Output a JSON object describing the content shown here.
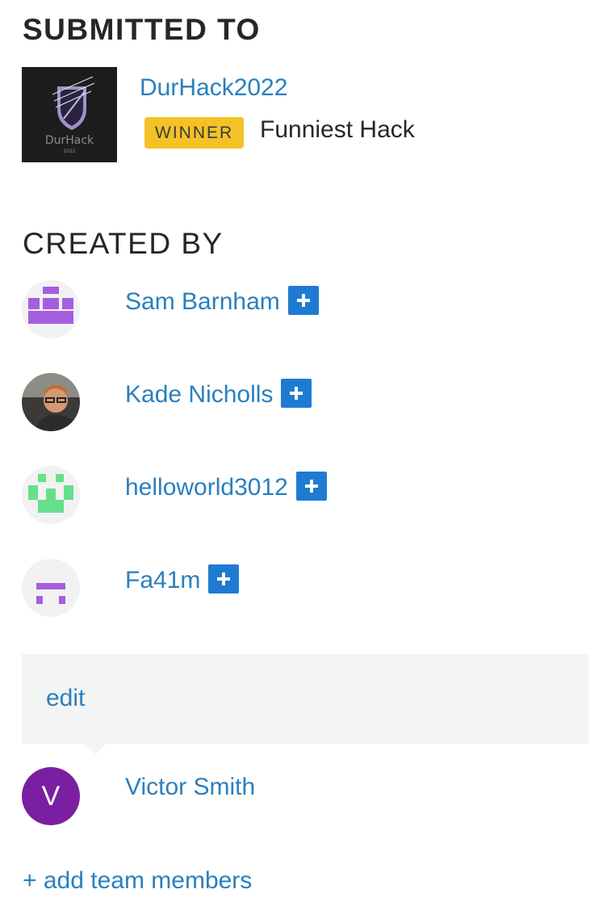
{
  "submitted": {
    "title": "SUBMITTED TO",
    "hackathon_name": "DurHack2022",
    "badge": "WINNER",
    "prize": "Funniest Hack",
    "logo_text": "DurHack",
    "logo_year": "2022"
  },
  "created": {
    "title": "CREATED BY",
    "members": [
      {
        "name": "Sam Barnham",
        "avatar": "purple-identicon",
        "color": "#a55ee0"
      },
      {
        "name": "Kade Nicholls",
        "avatar": "photo"
      },
      {
        "name": "helloworld3012",
        "avatar": "green-identicon",
        "color": "#66e08a"
      },
      {
        "name": "Fa41m",
        "avatar": "purple-identicon",
        "color": "#a55ee0"
      }
    ]
  },
  "edit": {
    "label": "edit"
  },
  "pending_member": {
    "initial": "V",
    "name": "Victor Smith",
    "color": "#7a1fa2"
  },
  "add_members": "+ add team members",
  "colors": {
    "link": "#2a7fbf",
    "badge": "#f4c226",
    "plus": "#1f7bd1"
  }
}
